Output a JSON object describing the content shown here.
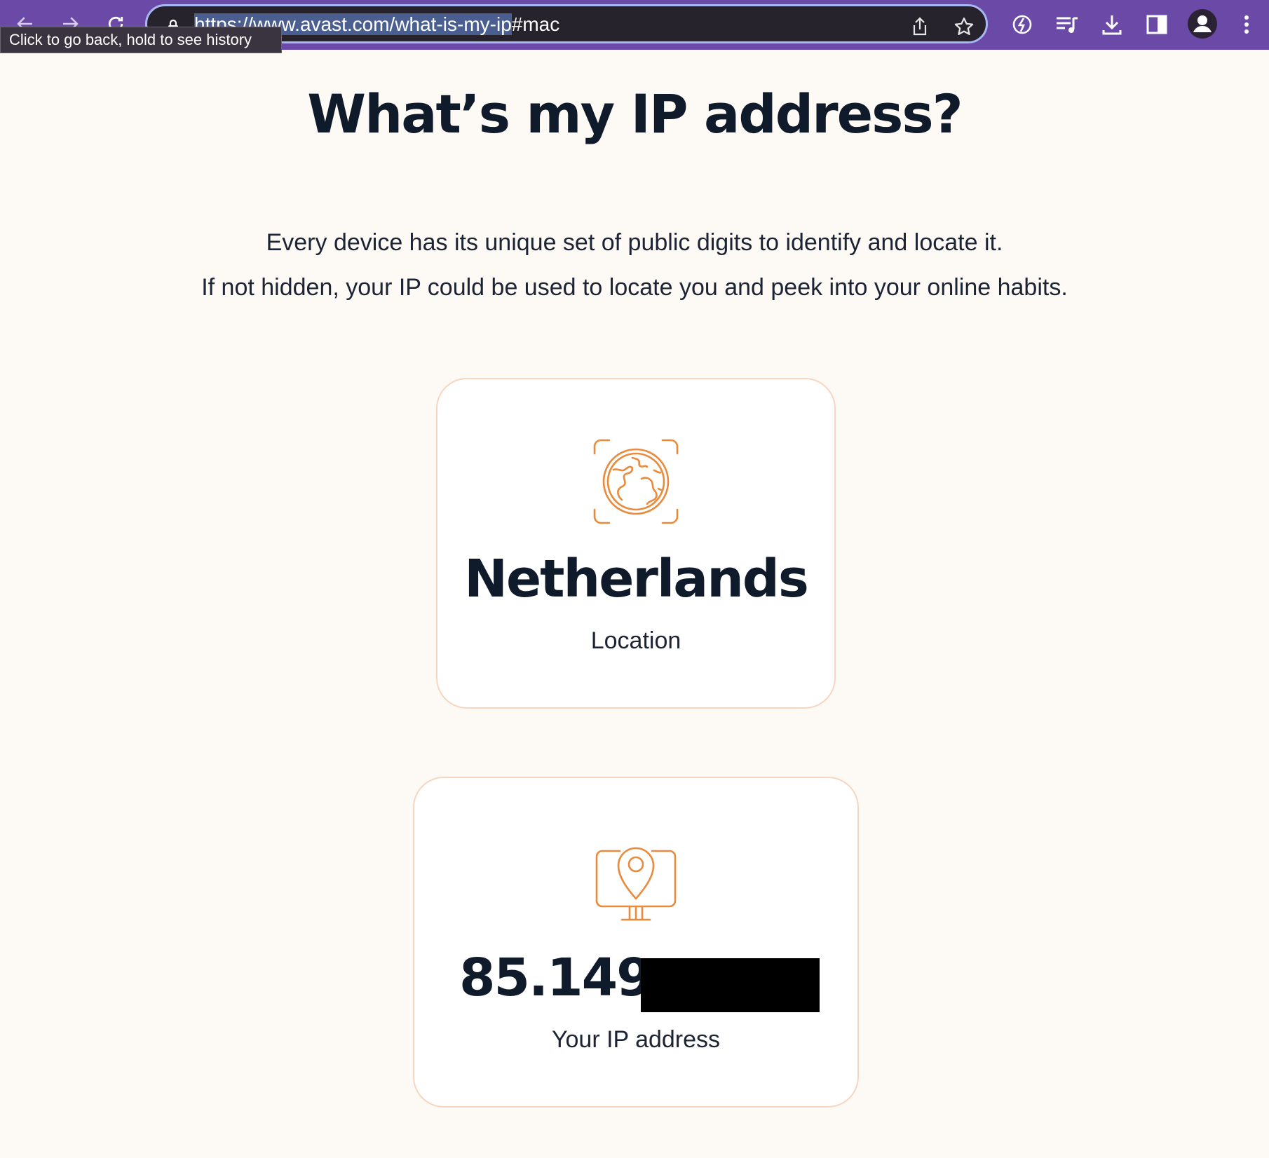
{
  "browser": {
    "url_selected": "https://www.avast.com/what-is-my-ip",
    "url_rest": "#mac",
    "tooltip": "Click to go back, hold to see history",
    "theme_color": "#6a4aa6"
  },
  "icons": {
    "back": "back-arrow-icon",
    "forward": "forward-arrow-icon",
    "reload": "reload-icon",
    "lock": "lock-icon",
    "share": "share-icon",
    "bookmark": "star-icon",
    "extension": "extension-icon",
    "reading_list": "reading-list-icon",
    "download": "download-icon",
    "side_panel": "side-panel-icon",
    "profile": "profile-icon",
    "menu": "more-vert-icon",
    "location_card": "globe-icon",
    "ip_card": "location-pin-monitor-icon"
  },
  "page": {
    "title": "What’s my IP address?",
    "intro_line1": "Every device has its unique set of public digits to identify and locate it.",
    "intro_line2": "If not hidden, your IP could be used to locate you and peek into your online habits."
  },
  "location_card": {
    "value": "Netherlands",
    "label": "Location"
  },
  "ip_card": {
    "value": "85.149.",
    "label": "Your IP address"
  },
  "colors": {
    "accent": "#e98a3c",
    "text_dark": "#0f1a2a",
    "card_border": "#f6d6bf"
  }
}
